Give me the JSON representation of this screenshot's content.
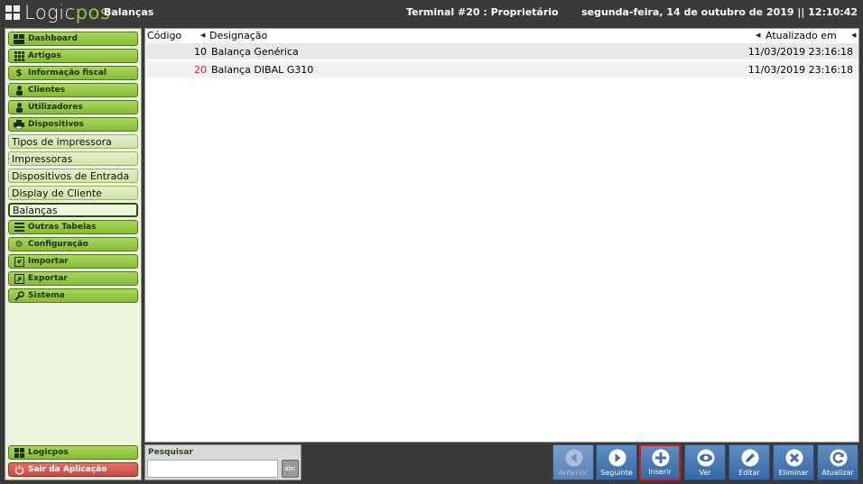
{
  "app": {
    "logo_part1": "Logic",
    "logo_part2": "pos",
    "page_name": "Balanças",
    "terminal": "Terminal #20 : Proprietário",
    "datetime": "segunda-feira, 14 de outubro de 2019 || 12:10:42"
  },
  "sidebar": {
    "menu": [
      {
        "label": "Dashboard",
        "icon": "dashboard-icon"
      },
      {
        "label": "Artigos",
        "icon": "grid-icon"
      },
      {
        "label": "Informação fiscal",
        "icon": "money-icon"
      },
      {
        "label": "Clientes",
        "icon": "person-icon"
      },
      {
        "label": "Utilizadores",
        "icon": "user-icon"
      },
      {
        "label": "Dispositivos",
        "icon": "printer-icon"
      }
    ],
    "sub": [
      "Tipos de impressora",
      "Impressoras",
      "Dispositivos de Entrada",
      "Display de Cliente",
      "Balanças"
    ],
    "menu2": [
      {
        "label": "Outras Tabelas",
        "icon": "list-icon"
      },
      {
        "label": "Configuração",
        "icon": "gear-icon"
      },
      {
        "label": "Importar",
        "icon": "import-icon"
      },
      {
        "label": "Exportar",
        "icon": "export-icon"
      },
      {
        "label": "Sistema",
        "icon": "wrench-icon"
      }
    ],
    "bottom": [
      {
        "label": "Logicpos",
        "icon": "grid-icon"
      },
      {
        "label": "Sair da Aplicação",
        "icon": "power-icon"
      }
    ]
  },
  "table": {
    "headers": [
      "Código",
      "Designação",
      "Atualizado em"
    ],
    "rows": [
      {
        "code": "10",
        "name": "Balança Genérica",
        "updated": "11/03/2019 23:16:18",
        "code_color": "#000000"
      },
      {
        "code": "20",
        "name": "Balança DIBAL G310",
        "updated": "11/03/2019 23:16:18",
        "code_color": "#d01d1d"
      }
    ]
  },
  "search": {
    "label": "Pesquisar",
    "value": "",
    "keyboard_label": "abc"
  },
  "toolbar": [
    {
      "label": "Anterior",
      "icon": "prev-icon",
      "state": "disabled"
    },
    {
      "label": "Seguinte",
      "icon": "next-icon",
      "state": "normal"
    },
    {
      "label": "Inserir",
      "icon": "plus-icon",
      "state": "selected"
    },
    {
      "label": "Ver",
      "icon": "eye-icon",
      "state": "normal"
    },
    {
      "label": "Editar",
      "icon": "pencil-icon",
      "state": "normal"
    },
    {
      "label": "Eliminar",
      "icon": "x-icon",
      "state": "normal"
    },
    {
      "label": "Atualizar",
      "icon": "refresh-icon",
      "state": "normal"
    }
  ],
  "colors": {
    "accent_green": "#8cc63f",
    "toolbar_blue": "#4a7ab6",
    "selected_border": "#d01d1d",
    "exit_red": "#c84a42"
  }
}
